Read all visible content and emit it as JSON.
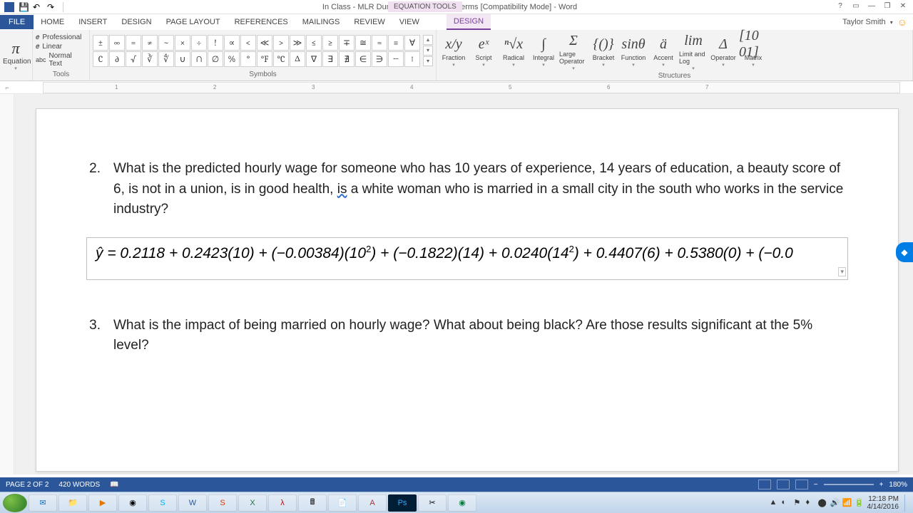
{
  "title": "In Class - MLR Dummy and Quadratic Terms [Compatibility Mode] - Word",
  "context_tab": "EQUATION TOOLS",
  "user": "Taylor Smith",
  "tabs": [
    "FILE",
    "HOME",
    "INSERT",
    "DESIGN",
    "PAGE LAYOUT",
    "REFERENCES",
    "MAILINGS",
    "REVIEW",
    "VIEW",
    "DESIGN"
  ],
  "ribbon": {
    "equation": "Equation",
    "tools": {
      "professional": "Professional",
      "linear": "Linear",
      "normal": "Normal Text",
      "label": "Tools"
    },
    "symbols_label": "Symbols",
    "symbols_row1": [
      "±",
      "∞",
      "=",
      "≠",
      "~",
      "×",
      "÷",
      "!",
      "∝",
      "<",
      "≪",
      ">",
      "≫",
      "≤",
      "≥",
      "∓",
      "≅",
      "≈",
      "≡",
      "∀"
    ],
    "symbols_row2": [
      "C",
      "∂",
      "√",
      "∛",
      "∜",
      "∪",
      "∩",
      "∅",
      "%",
      "°",
      "°F",
      "°C",
      "Δ",
      "∇",
      "∃",
      "∄",
      "∈",
      "∋",
      "←",
      "↑"
    ],
    "structures_label": "Structures",
    "structures": [
      {
        "icon": "x/y",
        "label": "Fraction"
      },
      {
        "icon": "eˣ",
        "label": "Script"
      },
      {
        "icon": "ⁿ√x",
        "label": "Radical"
      },
      {
        "icon": "∫",
        "label": "Integral"
      },
      {
        "icon": "Σ",
        "label": "Large Operator"
      },
      {
        "icon": "{()}",
        "label": "Bracket"
      },
      {
        "icon": "sinθ",
        "label": "Function"
      },
      {
        "icon": "ä",
        "label": "Accent"
      },
      {
        "icon": "lim",
        "label": "Limit and Log"
      },
      {
        "icon": "Δ",
        "label": "Operator"
      },
      {
        "icon": "[10 01]",
        "label": "Matrix"
      }
    ]
  },
  "ruler_marks": [
    "1",
    "2",
    "3",
    "4",
    "5",
    "6",
    "7"
  ],
  "doc": {
    "q2_num": "2.",
    "q2_text_a": "What is the predicted hourly wage for someone who has 10 years of experience, 14 years of education, a beauty score of 6, is not in a union, is in good health, ",
    "q2_is": "is",
    "q2_text_b": " a white woman who is married in a small city in the south who works in the service industry?",
    "equation": "ŷ = 0.2118 + 0.2423(10) + (−0.00384)(10²) + (−0.1822)(14) + 0.0240(14²) + 0.4407(6) + 0.5380(0) + (−0.0",
    "q3_num": "3.",
    "q3_text": "What is the impact of being married on hourly wage?  What about being black?  Are those results significant at the 5% level?"
  },
  "status": {
    "page": "PAGE 2 OF 2",
    "words": "420 WORDS",
    "zoom": "180%"
  },
  "taskbar": {
    "time": "12:18 PM",
    "date": "4/14/2016"
  }
}
